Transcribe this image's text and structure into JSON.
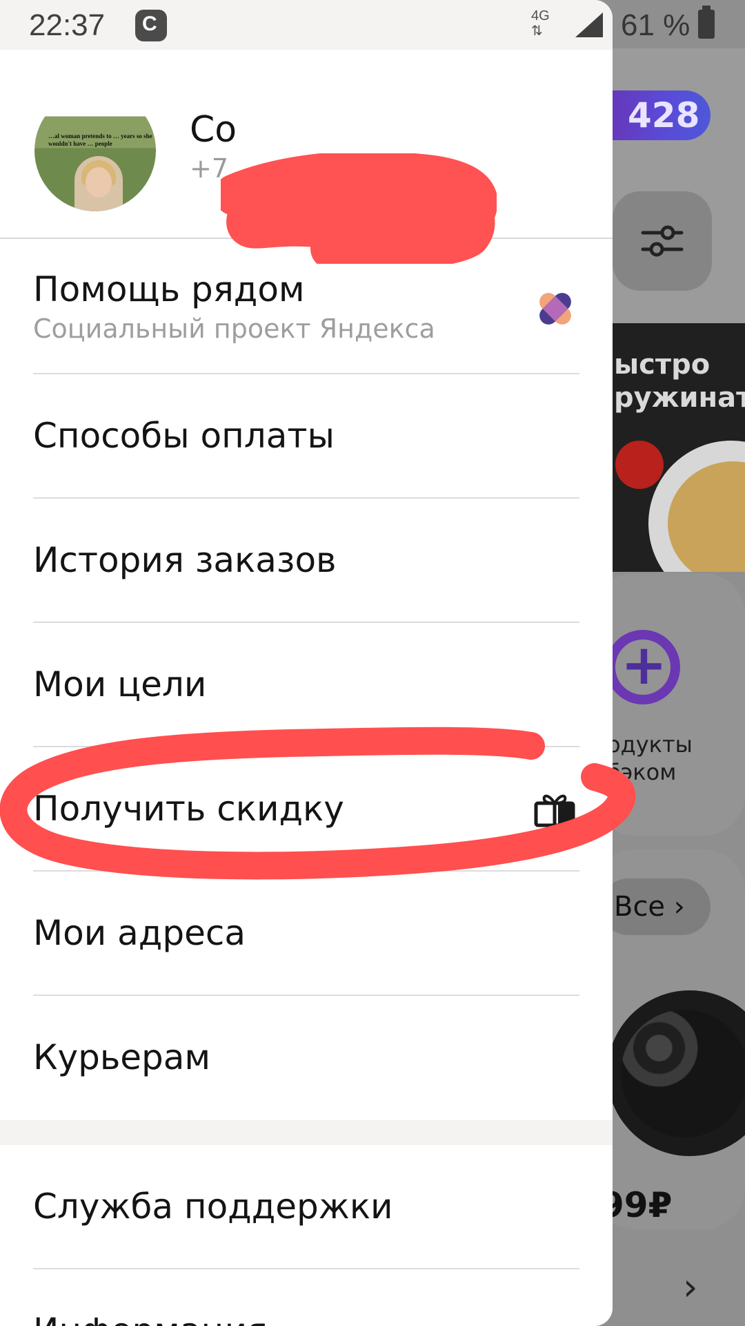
{
  "status_bar": {
    "time": "22:37",
    "network": "4G",
    "battery_percent": "61 %",
    "icons": [
      "app-c-icon",
      "signal-icon",
      "battery-icon"
    ]
  },
  "profile": {
    "avatar_caption": "…al woman pretends to … years so she wouldn't have … people",
    "name_visible": "Со",
    "phone_visible": "+7"
  },
  "menu": {
    "items": [
      {
        "label": "Помощь рядом",
        "sublabel": "Социальный проект Яндекса",
        "icon": "help-nearby-icon"
      },
      {
        "label": "Способы оплаты"
      },
      {
        "label": "История заказов"
      },
      {
        "label": "Мои цели"
      },
      {
        "label": "Получить скидку",
        "icon": "gift-icon"
      },
      {
        "label": "Мои адреса"
      },
      {
        "label": "Курьерам"
      },
      {
        "label": "Служба поддержки"
      },
      {
        "label": "Информация"
      }
    ]
  },
  "background": {
    "cashback": "428",
    "promo_text": "ыстро\nружинать",
    "plus_text": "одукты\nбэком",
    "all_button": "Все",
    "price": "99₽"
  },
  "colors": {
    "annotation": "#ff4f4f",
    "cashback_gradient_start": "#6a2fb0",
    "divider": "#dcdcdc"
  }
}
